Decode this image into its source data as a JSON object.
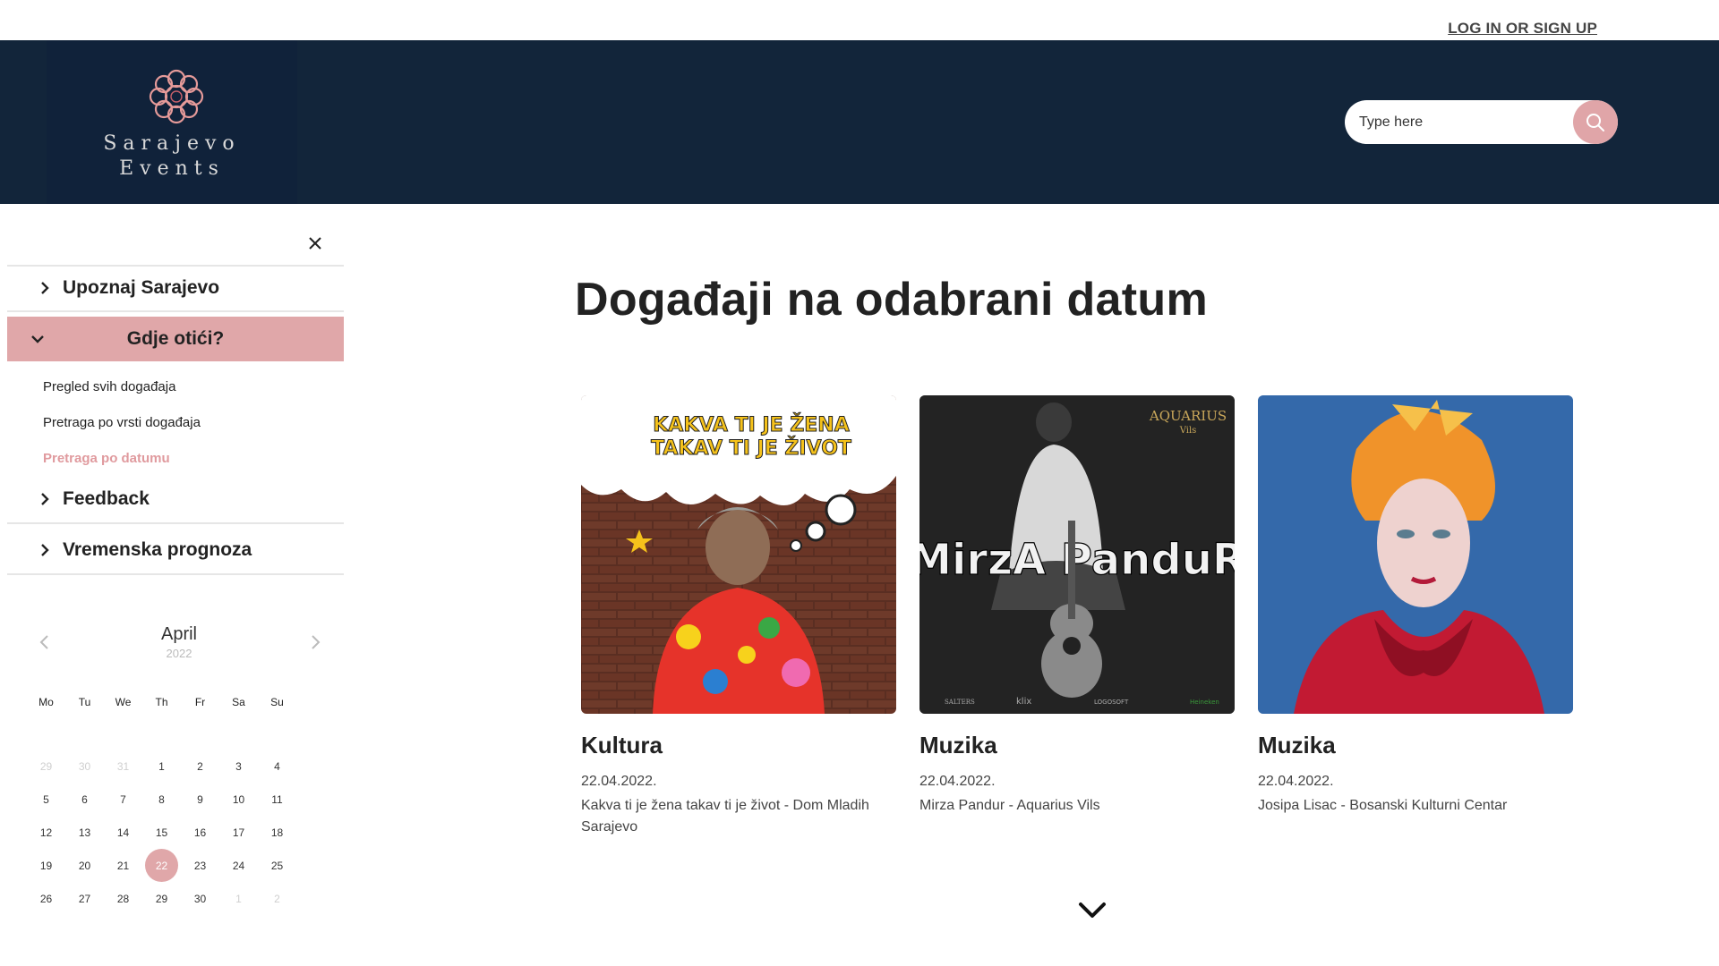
{
  "topbar": {
    "login_label": "LOG IN OR SIGN UP"
  },
  "header": {
    "logo_line1": "Sarajevo",
    "logo_line2": "Events",
    "search_placeholder": "Type here"
  },
  "sidebar": {
    "items": [
      {
        "label": "Upoznaj Sarajevo"
      },
      {
        "label": "Gdje otići?"
      },
      {
        "label": "Feedback"
      },
      {
        "label": "Vremenska prognoza"
      }
    ],
    "subitems": [
      {
        "label": "Pregled svih događaja"
      },
      {
        "label": "Pretraga po vrsti događaja"
      },
      {
        "label": "Pretraga po datumu"
      }
    ]
  },
  "calendar": {
    "month": "April",
    "year": "2022",
    "weekdays": [
      "Mo",
      "Tu",
      "We",
      "Th",
      "Fr",
      "Sa",
      "Su"
    ],
    "days": [
      {
        "d": "29",
        "m": true
      },
      {
        "d": "30",
        "m": true
      },
      {
        "d": "31",
        "m": true
      },
      {
        "d": "1"
      },
      {
        "d": "2"
      },
      {
        "d": "3"
      },
      {
        "d": "4"
      },
      {
        "d": "5"
      },
      {
        "d": "6"
      },
      {
        "d": "7"
      },
      {
        "d": "8"
      },
      {
        "d": "9"
      },
      {
        "d": "10"
      },
      {
        "d": "11"
      },
      {
        "d": "12"
      },
      {
        "d": "13"
      },
      {
        "d": "14"
      },
      {
        "d": "15"
      },
      {
        "d": "16"
      },
      {
        "d": "17"
      },
      {
        "d": "18"
      },
      {
        "d": "19"
      },
      {
        "d": "20"
      },
      {
        "d": "21"
      },
      {
        "d": "22",
        "s": true
      },
      {
        "d": "23"
      },
      {
        "d": "24"
      },
      {
        "d": "25"
      },
      {
        "d": "26"
      },
      {
        "d": "27"
      },
      {
        "d": "28"
      },
      {
        "d": "29"
      },
      {
        "d": "30"
      },
      {
        "d": "1",
        "m": true
      },
      {
        "d": "2",
        "m": true
      }
    ]
  },
  "main": {
    "title": "Događaji na odabrani datum",
    "cards": [
      {
        "category": "Kultura",
        "date": "22.04.2022.",
        "description": "Kakva ti je žena takav ti je život - Dom Mladih Sarajevo",
        "poster_line1": "KAKVA TI JE ŽENA",
        "poster_line2": "TAKAV TI JE ŽIVOT"
      },
      {
        "category": "Muzika",
        "date": "22.04.2022.",
        "description": "Mirza Pandur - Aquarius Vils",
        "poster_title": "MirzA PanduR",
        "poster_brand": "AQUARIUS",
        "poster_brand_sub": "Vils",
        "poster_sponsors": [
          "SALTERS",
          "klix",
          "LOGOSOFT",
          "Heineken"
        ]
      },
      {
        "category": "Muzika",
        "date": "22.04.2022.",
        "description": "Josipa Lisac - Bosanski Kulturni Centar"
      }
    ]
  },
  "colors": {
    "header_bg": "#12253a",
    "accent_pink": "#e0a7a9",
    "active_sub": "#e09a9e"
  }
}
